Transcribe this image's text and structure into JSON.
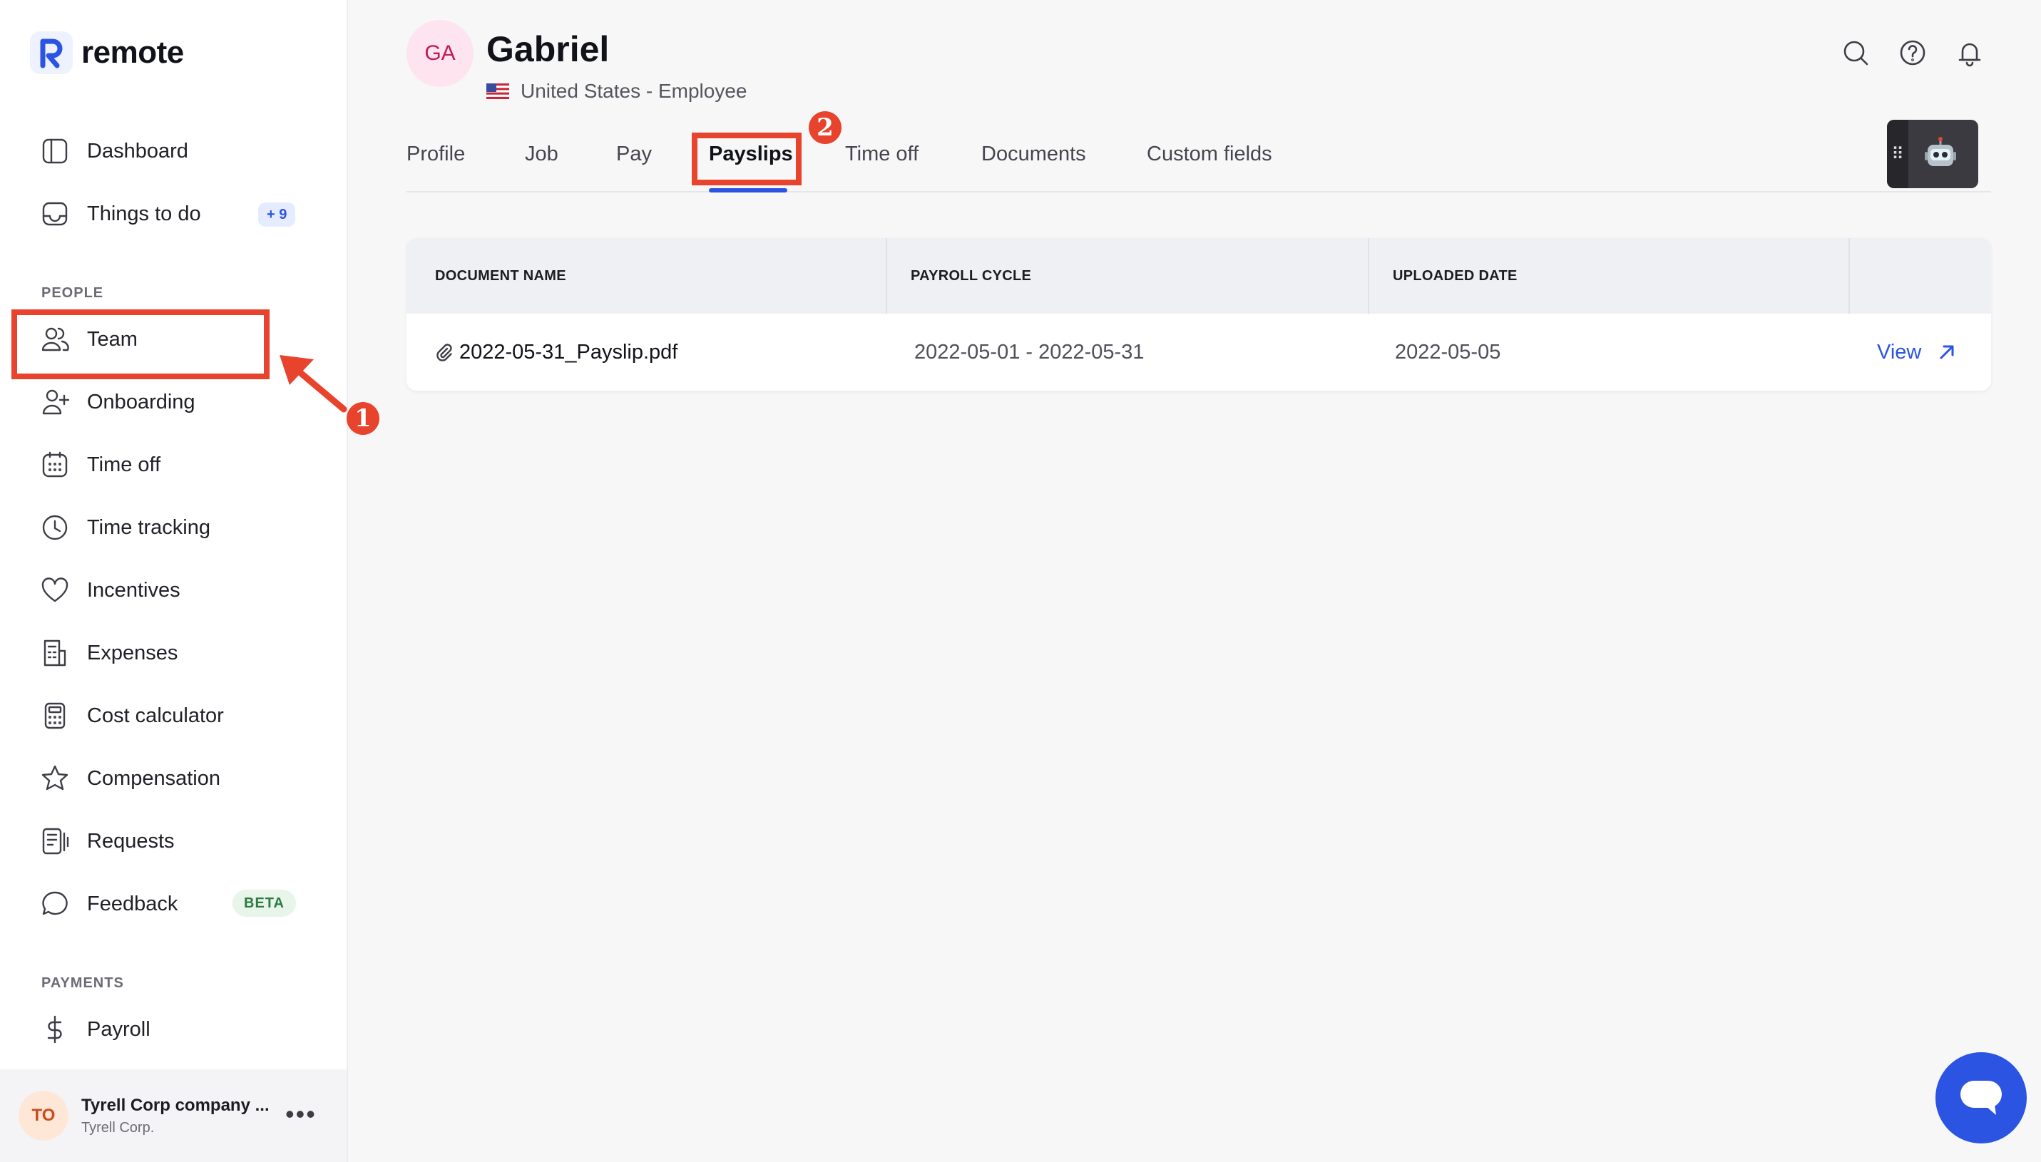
{
  "brand": {
    "name": "remote"
  },
  "sidebar": {
    "items": [
      {
        "label": "Dashboard",
        "icon": "dashboard-icon"
      },
      {
        "label": "Things to do",
        "icon": "inbox-icon",
        "badge": "+ 9"
      },
      {
        "label": "Team",
        "icon": "team-icon"
      },
      {
        "label": "Onboarding",
        "icon": "add-user-icon"
      },
      {
        "label": "Time off",
        "icon": "calendar-icon"
      },
      {
        "label": "Time tracking",
        "icon": "clock-icon"
      },
      {
        "label": "Incentives",
        "icon": "heart-icon"
      },
      {
        "label": "Expenses",
        "icon": "receipt-icon"
      },
      {
        "label": "Cost calculator",
        "icon": "calculator-icon"
      },
      {
        "label": "Compensation",
        "icon": "star-icon"
      },
      {
        "label": "Requests",
        "icon": "requests-icon"
      },
      {
        "label": "Feedback",
        "icon": "chat-bubble-icon",
        "badge": "BETA"
      },
      {
        "label": "Payroll",
        "icon": "dollar-icon"
      }
    ],
    "sections": {
      "people": "PEOPLE",
      "payments": "PAYMENTS"
    },
    "company": {
      "initials": "TO",
      "name": "Tyrell Corp company ...",
      "sub": "Tyrell Corp.",
      "more": "•••"
    }
  },
  "profile": {
    "initials": "GA",
    "name": "Gabriel",
    "subtitle": "United States - Employee"
  },
  "tabs": [
    {
      "label": "Profile"
    },
    {
      "label": "Job"
    },
    {
      "label": "Pay"
    },
    {
      "label": "Payslips",
      "active": true
    },
    {
      "label": "Time off"
    },
    {
      "label": "Documents"
    },
    {
      "label": "Custom fields"
    }
  ],
  "table": {
    "headers": [
      "DOCUMENT NAME",
      "PAYROLL CYCLE",
      "UPLOADED DATE"
    ],
    "rows": [
      {
        "name": "2022-05-31_Payslip.pdf",
        "cycle": "2022-05-01 - 2022-05-31",
        "uploaded": "2022-05-05",
        "action": "View"
      }
    ]
  },
  "annotations": {
    "one": "1",
    "two": "2"
  },
  "colors": {
    "accent": "#2b54e3",
    "annotation": "#e8432d"
  }
}
